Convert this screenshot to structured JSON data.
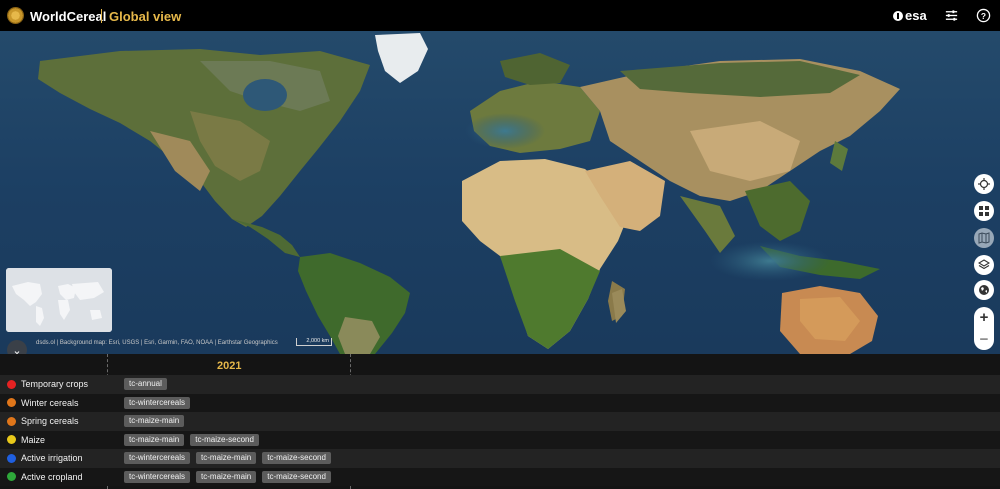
{
  "header": {
    "brand": "WorldCereal",
    "title": "Global view",
    "partner": "esa"
  },
  "map": {
    "attribution": "dsds.ol | Background map: Esri, USGS | Esri, Garmin, FAO, NOAA | Earthstar Geographics",
    "scale_label": "2,000 km"
  },
  "timeline": {
    "year": "2021",
    "rows": [
      {
        "label": "Temporary crops",
        "color": "#e52222",
        "tags": [
          "tc-annual"
        ]
      },
      {
        "label": "Winter cereals",
        "color": "#e0761a",
        "tags": [
          "tc-wintercereals"
        ]
      },
      {
        "label": "Spring cereals",
        "color": "#e0761a",
        "tags": [
          "tc-maize-main"
        ]
      },
      {
        "label": "Maize",
        "color": "#e8c81a",
        "tags": [
          "tc-maize-main",
          "tc-maize-second"
        ]
      },
      {
        "label": "Active irrigation",
        "color": "#1f5fe0",
        "tags": [
          "tc-wintercereals",
          "tc-maize-main",
          "tc-maize-second"
        ]
      },
      {
        "label": "Active cropland",
        "color": "#2ea83a",
        "tags": [
          "tc-wintercereals",
          "tc-maize-main",
          "tc-maize-second"
        ]
      }
    ]
  },
  "icons": [
    "globe-logo-icon",
    "settings-sliders-icon",
    "help-icon",
    "locate-icon",
    "layers-grid-icon",
    "map-icon",
    "layers-icon",
    "globe-icon",
    "chevron-down-icon"
  ]
}
